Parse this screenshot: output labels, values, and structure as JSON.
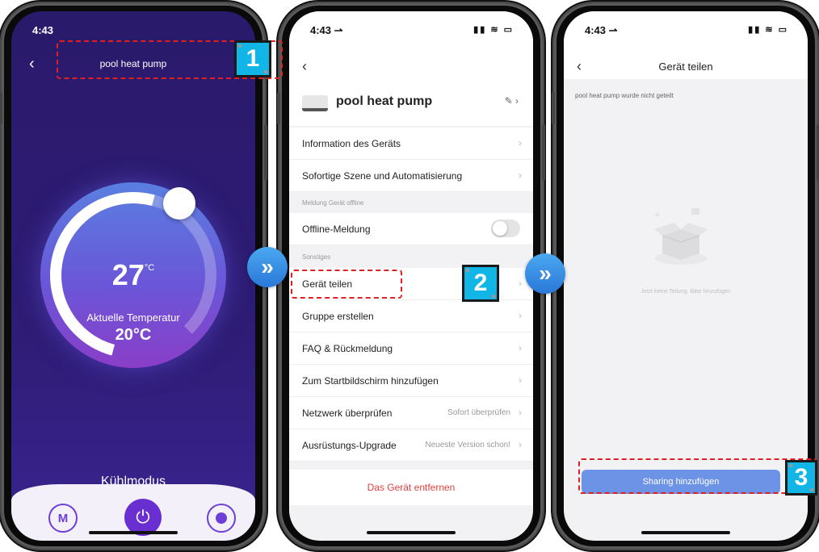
{
  "status": {
    "time1": "4:43",
    "time": "4:43 ⇀",
    "icons": "▮▮ ≋ ▭"
  },
  "screen1": {
    "title": "pool heat pump",
    "set_temp": "27",
    "set_unit": "°C",
    "current_label": "Aktuelle Temperatur",
    "current_temp": "20°C",
    "mode": "Kühlmodus",
    "mode_button": "M"
  },
  "screen2": {
    "device_name": "pool heat pump",
    "items": [
      {
        "label": "Information des Geräts"
      },
      {
        "label": "Sofortige Szene und Automatisierung"
      }
    ],
    "section_offline": "Meldung Gerät offline",
    "offline_label": "Offline-Meldung",
    "section_other": "Sonstiges",
    "other_items": [
      {
        "label": "Gerät teilen"
      },
      {
        "label": "Gruppe erstellen"
      },
      {
        "label": "FAQ & Rückmeldung"
      },
      {
        "label": "Zum Startbildschirm hinzufügen"
      },
      {
        "label": "Netzwerk überprüfen",
        "value": "Sofort überprüfen"
      },
      {
        "label": "Ausrüstungs-Upgrade",
        "value": "Neueste Version schon!"
      }
    ],
    "remove_label": "Das Gerät entfernen"
  },
  "screen3": {
    "title": "Gerät teilen",
    "note": "pool heat pump wurde nicht geteilt",
    "empty_text": "Jetzt keine Teilung. Bitte hinzufügen",
    "button": "Sharing hinzufügen"
  },
  "badges": [
    "1",
    "2",
    "3"
  ],
  "colors": {
    "accent_purple": "#6a2fd0",
    "share_blue": "#6d93e6",
    "remove_red": "#e04040",
    "callout_red": "#e02020",
    "badge_cyan": "#12b6e6"
  }
}
